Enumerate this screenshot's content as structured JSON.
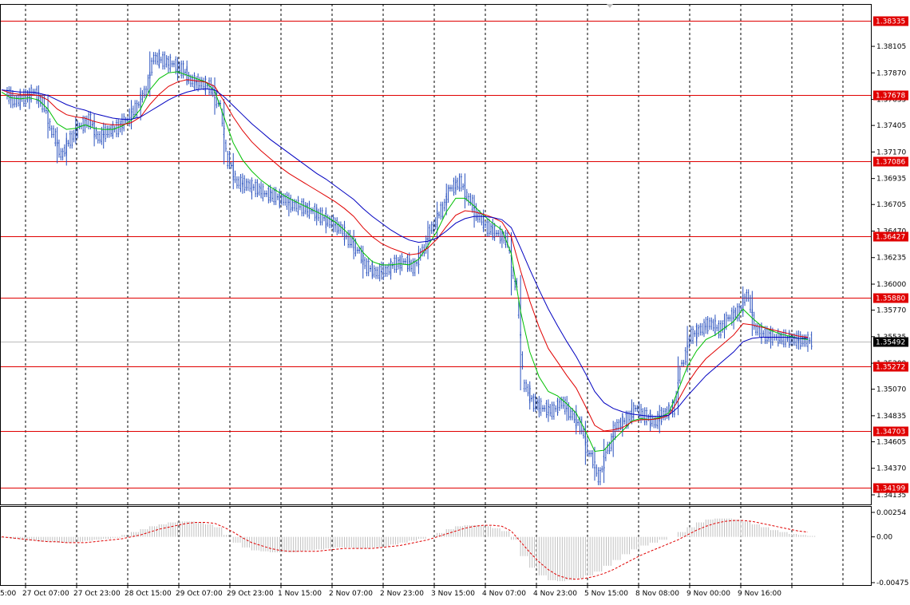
{
  "chart_data": [
    {
      "type": "candlestick",
      "title": "",
      "xlabel": "",
      "ylabel": "",
      "ylim": [
        1.3405,
        1.3848
      ],
      "grid": true,
      "y_ticks": [
        "1.38105",
        "1.37870",
        "1.37635",
        "1.37405",
        "1.37170",
        "1.36935",
        "1.36705",
        "1.36470",
        "1.36235",
        "1.36000",
        "1.35770",
        "1.35535",
        "1.35300",
        "1.35070",
        "1.34835",
        "1.34605",
        "1.34370",
        "1.34135"
      ],
      "x_tick_labels": [
        "5:00",
        "27 Oct 07:00",
        "27 Oct 23:00",
        "28 Oct 15:00",
        "29 Oct 07:00",
        "29 Oct 23:00",
        "1 Nov 15:00",
        "2 Nov 07:00",
        "2 Nov 23:00",
        "3 Nov 15:00",
        "4 Nov 07:00",
        "4 Nov 23:00",
        "5 Nov 15:00",
        "8 Nov 08:00",
        "9 Nov 00:00",
        "9 Nov 16:00"
      ],
      "support_resistance_levels": [
        {
          "label": "1.38335",
          "value": 1.38335
        },
        {
          "label": "1.37678",
          "value": 1.37678
        },
        {
          "label": "1.37086",
          "value": 1.37086
        },
        {
          "label": "1.36427",
          "value": 1.36427
        },
        {
          "label": "1.35880",
          "value": 1.3588
        },
        {
          "label": "1.35272",
          "value": 1.35272
        },
        {
          "label": "1.34703",
          "value": 1.34703
        },
        {
          "label": "1.34199",
          "value": 1.34199
        }
      ],
      "current_price": {
        "label": "1.35492",
        "value": 1.35492
      },
      "price_series_close": [
        1.3769,
        1.3762,
        1.3765,
        1.377,
        1.376,
        1.3735,
        1.3715,
        1.3728,
        1.374,
        1.3745,
        1.373,
        1.3735,
        1.3738,
        1.3745,
        1.3755,
        1.377,
        1.38,
        1.3798,
        1.3795,
        1.379,
        1.378,
        1.3778,
        1.3775,
        1.376,
        1.371,
        1.369,
        1.3688,
        1.3685,
        1.368,
        1.3678,
        1.3675,
        1.367,
        1.3668,
        1.3665,
        1.366,
        1.3655,
        1.365,
        1.364,
        1.363,
        1.3615,
        1.361,
        1.3612,
        1.3618,
        1.362,
        1.3615,
        1.363,
        1.365,
        1.3665,
        1.3685,
        1.369,
        1.3675,
        1.366,
        1.365,
        1.3645,
        1.364,
        1.36,
        1.351,
        1.3495,
        1.349,
        1.3488,
        1.3495,
        1.3485,
        1.3475,
        1.345,
        1.343,
        1.3455,
        1.3475,
        1.348,
        1.349,
        1.3483,
        1.3478,
        1.3485,
        1.349,
        1.353,
        1.3555,
        1.356,
        1.3565,
        1.356,
        1.357,
        1.3575,
        1.359,
        1.356,
        1.3555,
        1.3553,
        1.3552,
        1.3551,
        1.355,
        1.355
      ],
      "series": [
        {
          "name": "",
          "color": "#00c000",
          "values": [
            1.377,
            1.3765,
            1.3764,
            1.3765,
            1.3763,
            1.3755,
            1.3742,
            1.3737,
            1.3738,
            1.3741,
            1.3738,
            1.3737,
            1.3737,
            1.374,
            1.3745,
            1.3755,
            1.3772,
            1.3782,
            1.3787,
            1.3788,
            1.3785,
            1.3782,
            1.3779,
            1.3771,
            1.3748,
            1.3725,
            1.371,
            1.37,
            1.3692,
            1.3686,
            1.3681,
            1.3676,
            1.3672,
            1.3668,
            1.3664,
            1.366,
            1.3655,
            1.3648,
            1.364,
            1.3628,
            1.362,
            1.3617,
            1.3617,
            1.3618,
            1.3617,
            1.3622,
            1.3634,
            1.3647,
            1.3664,
            1.3676,
            1.3676,
            1.3669,
            1.3661,
            1.3654,
            1.3648,
            1.3627,
            1.3576,
            1.354,
            1.3518,
            1.3505,
            1.3501,
            1.3494,
            1.3486,
            1.347,
            1.3452,
            1.3453,
            1.3462,
            1.347,
            1.3479,
            1.3481,
            1.348,
            1.3482,
            1.3486,
            1.3506,
            1.3527,
            1.3541,
            1.3551,
            1.3555,
            1.3561,
            1.3567,
            1.3578,
            1.357,
            1.3563,
            1.3559,
            1.3556,
            1.3554,
            1.3552,
            1.3551
          ]
        },
        {
          "name": "",
          "color": "#e00000",
          "values": [
            1.3772,
            1.3769,
            1.3768,
            1.3768,
            1.3767,
            1.3763,
            1.3755,
            1.375,
            1.3748,
            1.3747,
            1.3744,
            1.3742,
            1.3741,
            1.3741,
            1.3743,
            1.3748,
            1.3759,
            1.3768,
            1.3775,
            1.3779,
            1.3781,
            1.378,
            1.3779,
            1.3775,
            1.3762,
            1.3748,
            1.3736,
            1.3726,
            1.3718,
            1.3711,
            1.3704,
            1.3698,
            1.3693,
            1.3688,
            1.3683,
            1.3678,
            1.3673,
            1.3667,
            1.366,
            1.365,
            1.3642,
            1.3636,
            1.3632,
            1.3629,
            1.3626,
            1.3627,
            1.3632,
            1.364,
            1.3651,
            1.3661,
            1.3665,
            1.3664,
            1.3662,
            1.3659,
            1.3655,
            1.3642,
            1.3612,
            1.3585,
            1.3562,
            1.3543,
            1.3531,
            1.3519,
            1.3508,
            1.3492,
            1.3475,
            1.347,
            1.3471,
            1.3473,
            1.3478,
            1.348,
            1.348,
            1.3481,
            1.3484,
            1.3497,
            1.3512,
            1.3524,
            1.3534,
            1.3541,
            1.3548,
            1.3555,
            1.3565,
            1.3564,
            1.3562,
            1.356,
            1.3558,
            1.3556,
            1.3554,
            1.3553
          ]
        },
        {
          "name": "",
          "color": "#0000c0",
          "values": [
            1.3772,
            1.3771,
            1.377,
            1.377,
            1.3769,
            1.3767,
            1.3763,
            1.3759,
            1.3756,
            1.3754,
            1.3751,
            1.3749,
            1.3747,
            1.3746,
            1.3746,
            1.3748,
            1.3753,
            1.3758,
            1.3763,
            1.3767,
            1.377,
            1.3772,
            1.3773,
            1.3772,
            1.3766,
            1.3758,
            1.375,
            1.3742,
            1.3735,
            1.3728,
            1.3722,
            1.3716,
            1.371,
            1.3704,
            1.3698,
            1.3693,
            1.3687,
            1.3681,
            1.3675,
            1.3667,
            1.366,
            1.3654,
            1.3648,
            1.3643,
            1.3639,
            1.3637,
            1.3638,
            1.3641,
            1.3647,
            1.3654,
            1.3658,
            1.366,
            1.366,
            1.3659,
            1.3657,
            1.365,
            1.3632,
            1.3613,
            1.3595,
            1.3578,
            1.3563,
            1.3549,
            1.3536,
            1.3521,
            1.3505,
            1.3495,
            1.349,
            1.3487,
            1.3485,
            1.3484,
            1.3483,
            1.3483,
            1.3484,
            1.3491,
            1.3501,
            1.351,
            1.3519,
            1.3526,
            1.3533,
            1.354,
            1.3549,
            1.3552,
            1.3553,
            1.3553,
            1.3553,
            1.3553,
            1.3552,
            1.3552
          ]
        }
      ]
    },
    {
      "type": "histogram-with-signal",
      "ylim": [
        -0.005,
        0.0032
      ],
      "y_ticks": [
        "0.00254",
        "0.00",
        "-0.00475"
      ],
      "histogram": [
        -0.0001,
        -0.0002,
        -0.0003,
        -0.0004,
        -0.0005,
        -0.0005,
        -0.0006,
        -0.0006,
        -0.0005,
        -0.0004,
        -0.0003,
        -0.0002,
        -0.0001,
        0.0002,
        0.0005,
        0.0008,
        0.0011,
        0.0013,
        0.0015,
        0.0016,
        0.0016,
        0.0015,
        0.0013,
        0.001,
        0.0002,
        -0.0006,
        -0.0011,
        -0.0014,
        -0.0015,
        -0.0016,
        -0.0016,
        -0.0016,
        -0.0015,
        -0.0014,
        -0.0013,
        -0.0012,
        -0.0011,
        -0.0011,
        -0.0012,
        -0.0012,
        -0.0011,
        -0.001,
        -0.0008,
        -0.0006,
        -0.0004,
        -0.0002,
        0.0,
        0.0004,
        0.0008,
        0.0011,
        0.0012,
        0.0012,
        0.0011,
        0.0009,
        0.0006,
        -0.0003,
        -0.002,
        -0.0032,
        -0.004,
        -0.0045,
        -0.0046,
        -0.0045,
        -0.0043,
        -0.004,
        -0.0036,
        -0.003,
        -0.0024,
        -0.0018,
        -0.0013,
        -0.0009,
        -0.0006,
        -0.0003,
        0.0,
        0.0005,
        0.001,
        0.0015,
        0.0018,
        0.0019,
        0.0019,
        0.0018,
        0.0016,
        0.0013,
        0.001,
        0.0007,
        0.0005,
        0.0003,
        0.0002,
        0.0001
      ],
      "signal": [
        0.0,
        -0.0001,
        -0.0002,
        -0.0003,
        -0.0004,
        -0.0005,
        -0.0005,
        -0.0006,
        -0.0006,
        -0.0006,
        -0.0005,
        -0.0004,
        -0.0003,
        -0.0002,
        0.0,
        0.0002,
        0.0005,
        0.0008,
        0.001,
        0.0012,
        0.0014,
        0.0015,
        0.0015,
        0.0014,
        0.001,
        0.0005,
        -0.0001,
        -0.0006,
        -0.0009,
        -0.0012,
        -0.0014,
        -0.0015,
        -0.0015,
        -0.0015,
        -0.0015,
        -0.0014,
        -0.0013,
        -0.0012,
        -0.0012,
        -0.0012,
        -0.0012,
        -0.0011,
        -0.001,
        -0.0009,
        -0.0007,
        -0.0005,
        -0.0003,
        0.0,
        0.0003,
        0.0006,
        0.0009,
        0.0011,
        0.0012,
        0.0012,
        0.0011,
        0.0006,
        -0.0005,
        -0.0016,
        -0.0026,
        -0.0034,
        -0.004,
        -0.0043,
        -0.0044,
        -0.0043,
        -0.0041,
        -0.0038,
        -0.0034,
        -0.0029,
        -0.0024,
        -0.0019,
        -0.0015,
        -0.0011,
        -0.0007,
        -0.0003,
        0.0002,
        0.0007,
        0.0011,
        0.0014,
        0.0016,
        0.0017,
        0.0017,
        0.0016,
        0.0014,
        0.0012,
        0.001,
        0.0008,
        0.0006,
        0.0005
      ]
    }
  ]
}
